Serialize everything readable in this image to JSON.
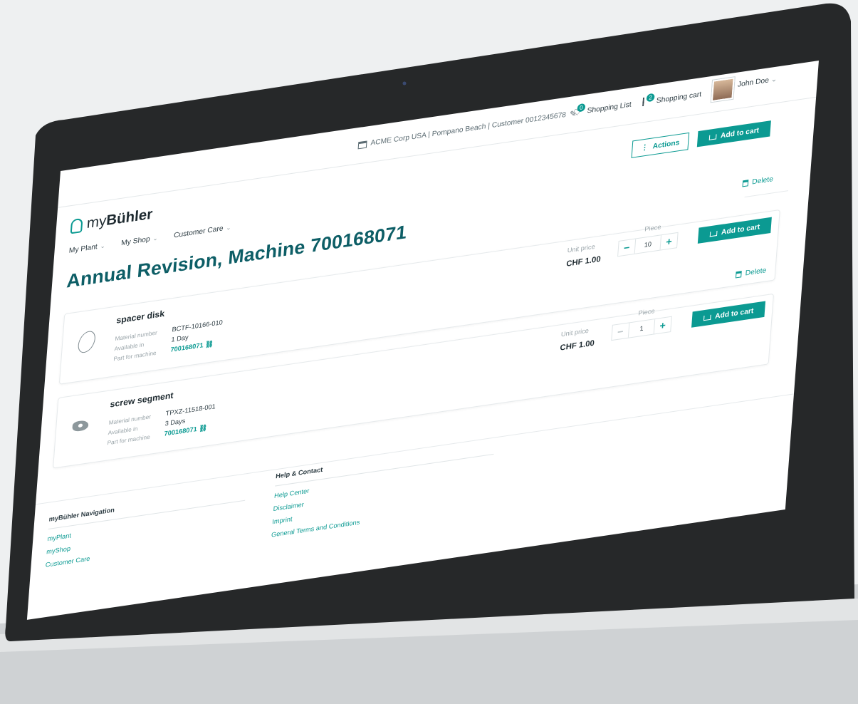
{
  "topbar": {
    "company": "ACME Corp USA | Pompano Beach | Customer 0012345678",
    "shopping_list": {
      "count": "0",
      "label": "Shopping List"
    },
    "shopping_cart": {
      "count": "2",
      "label": "Shopping cart"
    },
    "user": "John Doe"
  },
  "header": {
    "logo_prefix": "my",
    "logo_brand": "Bühler",
    "nav": [
      "My Plant",
      "My Shop",
      "Customer Care"
    ],
    "actions_label": "Actions",
    "add_all_label": "Add to cart"
  },
  "page_title": "Annual Revision, Machine 700168071",
  "labels": {
    "delete": "Delete",
    "material_number": "Material number",
    "available_in": "Available in",
    "part_for_machine": "Part for machine",
    "unit_price": "Unit price",
    "piece": "Piece",
    "add_to_cart": "Add to cart"
  },
  "items": [
    {
      "name": "spacer disk",
      "material_number": "BCTF-10166-010",
      "available_in": "1 Day",
      "machine": "700168071",
      "price": "CHF 1.00",
      "quantity": "10"
    },
    {
      "name": "screw segment",
      "material_number": "TPXZ-11518-001",
      "available_in": "3 Days",
      "machine": "700168071",
      "price": "CHF 1.00",
      "quantity": "1"
    }
  ],
  "footer": {
    "nav_title": "myBühler Navigation",
    "nav_links": [
      "myPlant",
      "myShop",
      "Customer Care"
    ],
    "help_title": "Help & Contact",
    "help_links": [
      "Help Center",
      "Disclaimer",
      "Imprint",
      "General Terms and Conditions"
    ]
  },
  "colors": {
    "accent": "#0b9a92",
    "title": "#0d5e66"
  }
}
